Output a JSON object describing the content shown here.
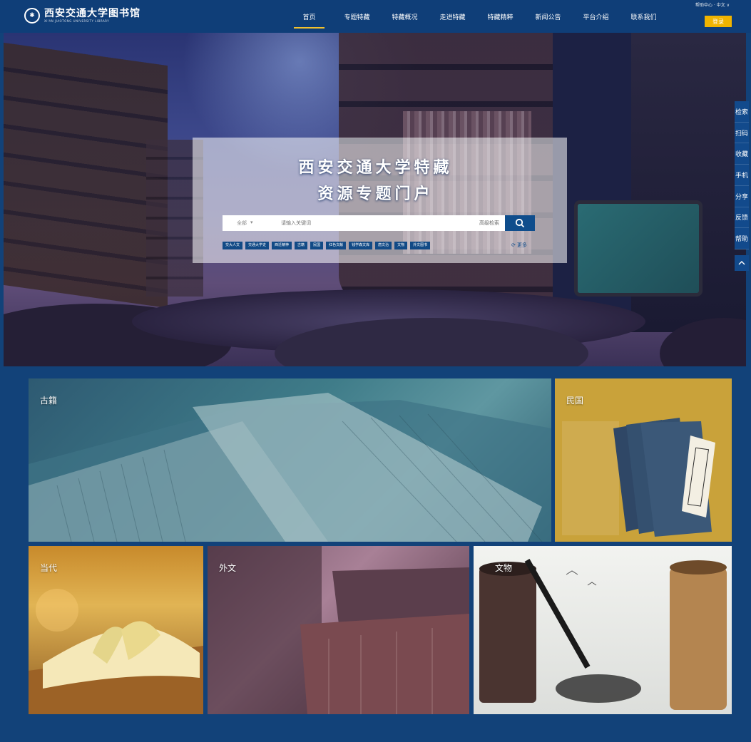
{
  "header": {
    "logo_seal": "✱",
    "logo_text": "西安交通大学图书馆",
    "logo_sub": "XI'AN JIAOTONG UNIVERSITY LIBRARY",
    "nav": [
      "首页",
      "专题特藏",
      "特藏概况",
      "走进特藏",
      "特藏精粹",
      "新闻公告",
      "平台介绍",
      "联系我们"
    ],
    "top_links": "帮助中心 · 中文 ∨",
    "login": "登录"
  },
  "hero": {
    "title_line1": "西安交通大学特藏",
    "title_line2": "资源专题门户",
    "search": {
      "select": "全部",
      "placeholder": "请输入关键词",
      "advanced": "高级检索"
    },
    "tags": [
      "交大人文",
      "交通大学史",
      "西迁精神",
      "古籍",
      "民国",
      "红色文献",
      "钱学森文库",
      "唐文治",
      "文物",
      "外文图书"
    ],
    "more": "更多"
  },
  "toolbar": [
    "检索",
    "扫码",
    "收藏",
    "手机",
    "分享",
    "反馈",
    "帮助"
  ],
  "tiles": {
    "guji": "古籍",
    "minguo": "民国",
    "dangdai": "当代",
    "waiwen": "外文",
    "wenwu": "文物"
  },
  "colors": {
    "primary": "#0f3e78",
    "accent": "#f0b400"
  }
}
